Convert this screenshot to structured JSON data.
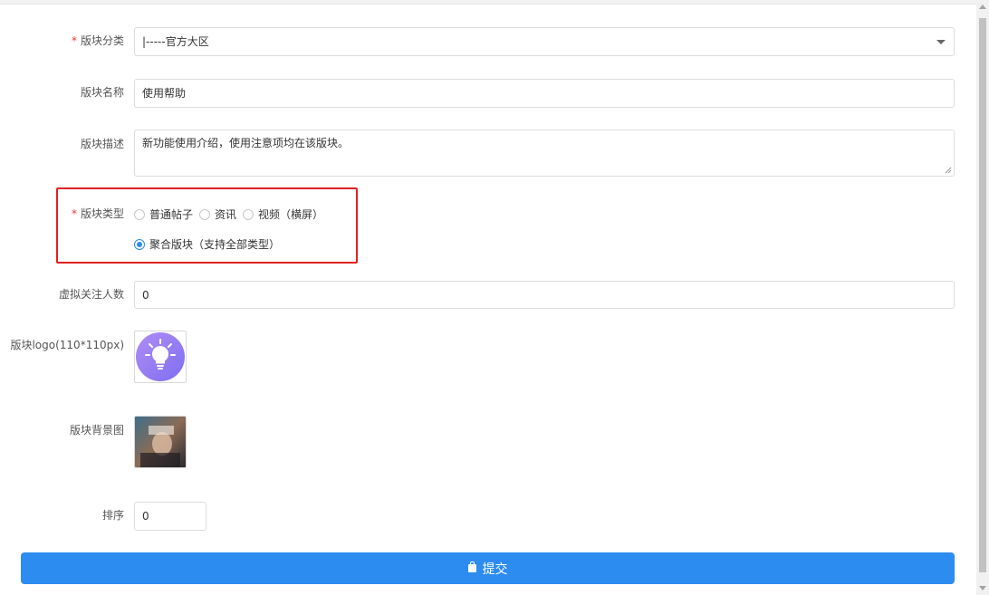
{
  "form": {
    "category": {
      "label": "版块分类",
      "required_mark": "*",
      "value": "|-----官方大区"
    },
    "name": {
      "label": "版块名称",
      "value": "使用帮助"
    },
    "description": {
      "label": "版块描述",
      "value": "新功能使用介绍，使用注意项均在该版块。"
    },
    "type": {
      "label": "版块类型",
      "required_mark": "*",
      "options": [
        {
          "label": "普通帖子",
          "checked": false
        },
        {
          "label": "资讯",
          "checked": false
        },
        {
          "label": "视频（横屏）",
          "checked": false
        },
        {
          "label": "聚合版块（支持全部类型）",
          "checked": true
        }
      ]
    },
    "followers": {
      "label": "虚拟关注人数",
      "value": "0"
    },
    "logo": {
      "label": "版块logo(110*110px)",
      "icon": "lightbulb-icon"
    },
    "background": {
      "label": "版块背景图"
    },
    "sort": {
      "label": "排序",
      "value": "0"
    },
    "submit_label": "提交"
  },
  "colors": {
    "primary": "#2d8cf0",
    "highlight": "#e02020",
    "required": "#e4393c"
  }
}
